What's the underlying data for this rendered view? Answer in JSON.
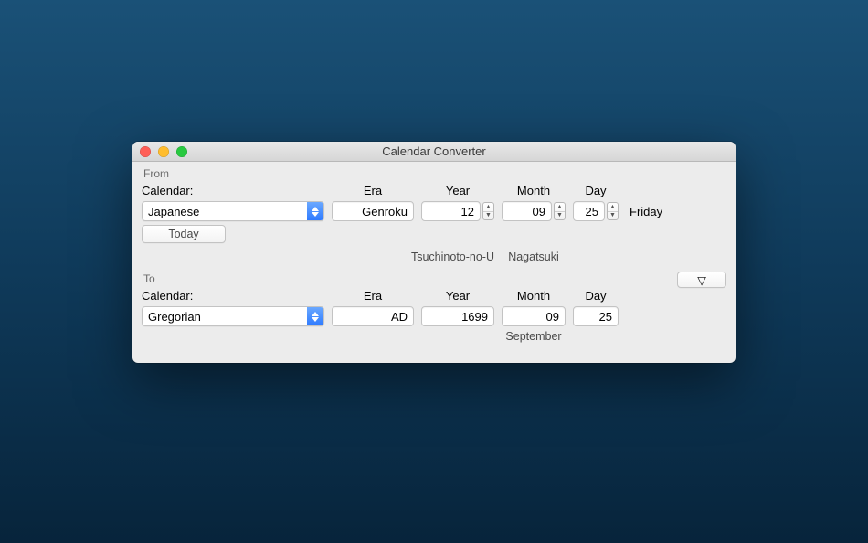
{
  "window": {
    "title": "Calendar Converter"
  },
  "from": {
    "group_label": "From",
    "calendar_label": "Calendar:",
    "headers": {
      "era": "Era",
      "year": "Year",
      "month": "Month",
      "day": "Day"
    },
    "calendar_value": "Japanese",
    "era": "Genroku",
    "year": "12",
    "month": "09",
    "day": "25",
    "weekday": "Friday",
    "today_label": "Today",
    "year_name": "Tsuchinoto-no-U",
    "month_name": "Nagatsuki"
  },
  "to": {
    "group_label": "To",
    "calendar_label": "Calendar:",
    "headers": {
      "era": "Era",
      "year": "Year",
      "month": "Month",
      "day": "Day"
    },
    "calendar_value": "Gregorian",
    "era": "AD",
    "year": "1699",
    "month": "09",
    "day": "25",
    "month_name": "September"
  },
  "expand_glyph": "▽"
}
